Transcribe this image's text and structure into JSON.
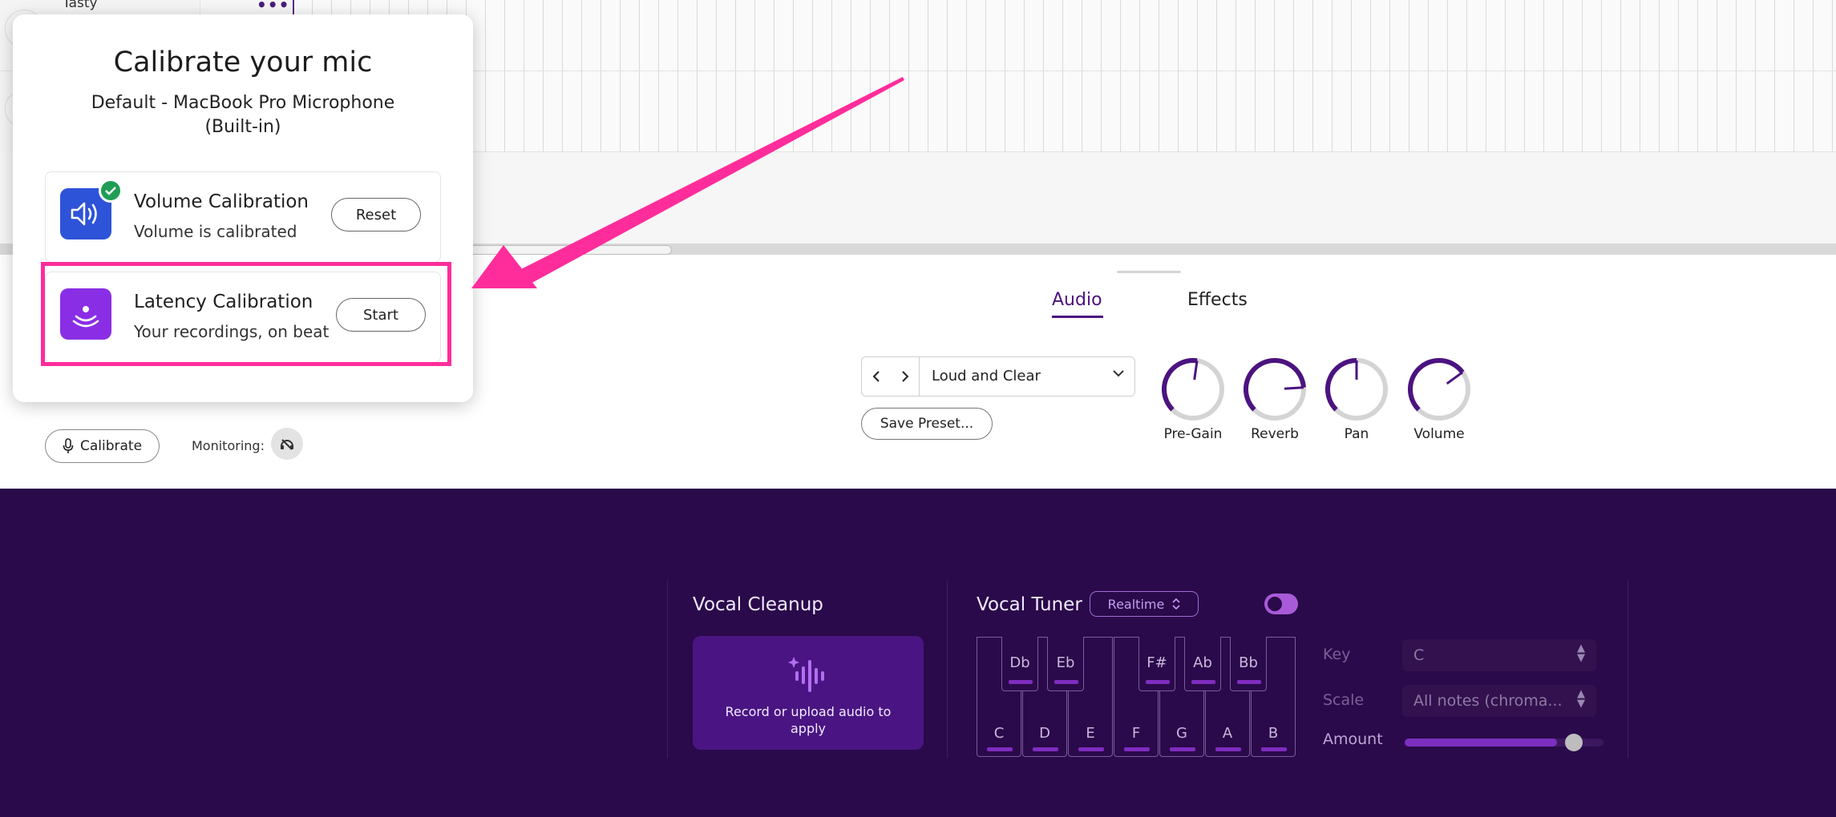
{
  "track": {
    "name": "Tasty"
  },
  "tabs": [
    {
      "label": "Audio"
    },
    {
      "label": "Effects"
    }
  ],
  "preset": {
    "prev_icon": "chevron-left-icon",
    "next_icon": "chevron-right-icon",
    "name": "Loud and Clear",
    "save_label": "Save Preset..."
  },
  "knobs": [
    {
      "label": "Pre-Gain",
      "level": 0.53
    },
    {
      "label": "Reverb",
      "level": 0.82
    },
    {
      "label": "Pan",
      "level": 0.5
    },
    {
      "label": "Volume",
      "level": 0.7
    }
  ],
  "controls": {
    "calibrate_label": "Calibrate",
    "monitoring_label": "Monitoring:"
  },
  "popup": {
    "title": "Calibrate your mic",
    "device": "Default - MacBook Pro Microphone (Built-in)",
    "volume": {
      "title": "Volume Calibration",
      "subtitle": "Volume is calibrated",
      "button": "Reset",
      "icon": "speaker-icon",
      "status_icon": "checkmark-icon"
    },
    "latency": {
      "title": "Latency Calibration",
      "subtitle": "Your recordings, on beat",
      "button": "Start",
      "icon": "latency-person-icon"
    }
  },
  "vocal_cleanup": {
    "title": "Vocal Cleanup",
    "hint": "Record or upload audio to apply"
  },
  "vocal_tuner": {
    "title": "Vocal Tuner",
    "mode": "Realtime",
    "enabled": true,
    "white_keys": [
      "C",
      "D",
      "E",
      "F",
      "G",
      "A",
      "B"
    ],
    "black_keys": [
      "Db",
      "Eb",
      "F#",
      "Ab",
      "Bb"
    ],
    "key_label": "Key",
    "key_value": "C",
    "scale_label": "Scale",
    "scale_value": "All notes (chroma...",
    "amount_label": "Amount",
    "amount": 0.85
  },
  "colors": {
    "accent_purple": "#4b1380",
    "bottom_bg": "#2a0a4a",
    "highlight": "#ff2d9b",
    "volume_icon_bg": "#2d53d9",
    "latency_icon_bg": "#8a2ee6",
    "check_green": "#1f9d55"
  }
}
